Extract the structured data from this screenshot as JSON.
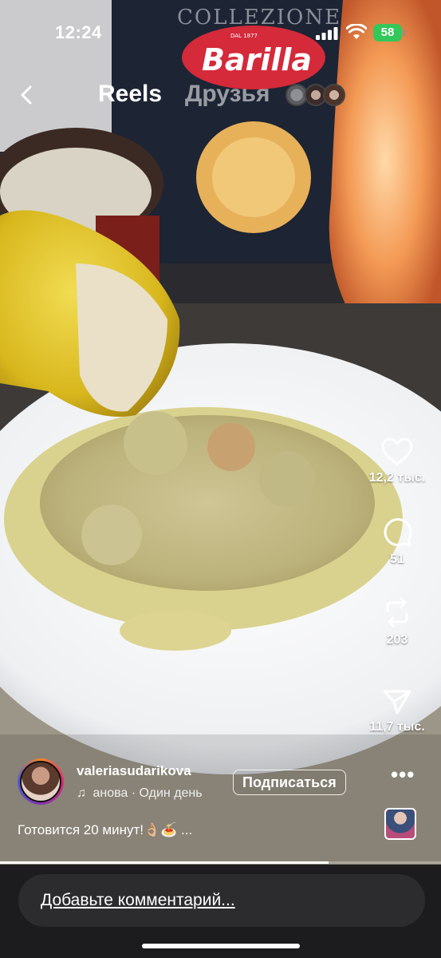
{
  "status_bar": {
    "time": "12:24",
    "battery": "58"
  },
  "nav": {
    "tab_reels": "Reels",
    "tab_friends": "Друзья"
  },
  "video": {
    "background_art": {
      "box_line": "COLLEZIONE",
      "box_brand": "Barilla",
      "box_badge": "DAL 1877"
    }
  },
  "actions": {
    "likes": "12,2 тыс.",
    "comments": "51",
    "reposts": "203",
    "shares": "11,7 тыс."
  },
  "author": {
    "username": "valeriasudarikova",
    "audio_track": "анова",
    "audio_time": "· Один день",
    "follow_label": "Подписаться"
  },
  "caption": "Готовится 20 минут!👌🏼🍝 ...",
  "comment_box": {
    "placeholder": "Добавьте комментарий..."
  },
  "progress": {
    "fraction": 0.745
  },
  "icons": [
    "back-icon",
    "heart-icon",
    "comment-icon",
    "repost-icon",
    "send-icon",
    "more-icon",
    "music-note-icon",
    "wifi-icon",
    "signal-icon",
    "battery-icon"
  ]
}
